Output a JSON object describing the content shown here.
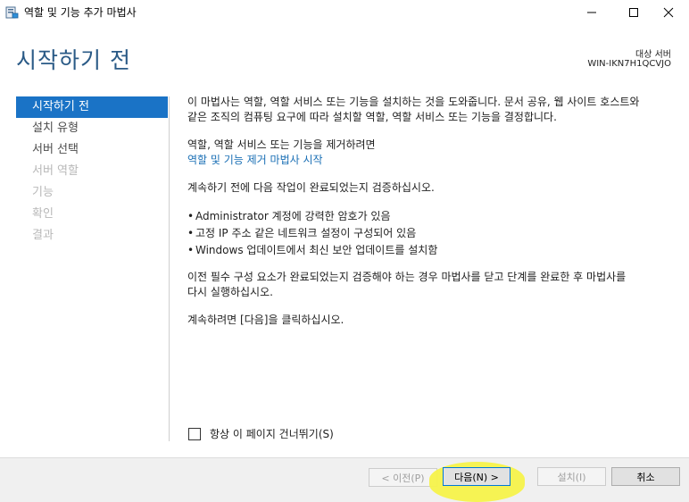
{
  "window": {
    "title": "역할 및 기능 추가 마법사",
    "icon": "server-manager-icon",
    "controls": [
      "minimize-icon",
      "maximize-icon",
      "close-icon"
    ]
  },
  "header": {
    "page_title": "시작하기 전",
    "target_label": "대상 서버",
    "target_server": "WIN-IKN7H1QCVJO"
  },
  "nav": {
    "items": [
      {
        "label": "시작하기 전",
        "state": "active"
      },
      {
        "label": "설치 유형",
        "state": "enabled"
      },
      {
        "label": "서버 선택",
        "state": "enabled"
      },
      {
        "label": "서버 역할",
        "state": "disabled"
      },
      {
        "label": "기능",
        "state": "disabled"
      },
      {
        "label": "확인",
        "state": "disabled"
      },
      {
        "label": "결과",
        "state": "disabled"
      }
    ]
  },
  "content": {
    "intro_line1": "이 마법사는 역할, 역할 서비스 또는 기능을 설치하는 것을 도와줍니다. 문서 공유, 웹 사이트 호스트와",
    "intro_line2": "같은 조직의 컴퓨팅 요구에 따라 설치할 역할, 역할 서비스 또는 기능을 결정합니다.",
    "remove_heading": "역할, 역할 서비스 또는 기능을 제거하려면",
    "remove_link": "역할 및 기능 제거 마법사 시작",
    "verify_heading": "계속하기 전에 다음 작업이 완료되었는지 검증하십시오.",
    "bullets": [
      "Administrator 계정에 강력한 암호가 있음",
      "고정 IP 주소 같은 네트워크 설정이 구성되어 있음",
      "Windows 업데이트에서 최신 보안 업데이트를 설치함"
    ],
    "prereq_line1": "이전 필수 구성 요소가 완료되었는지 검증해야 하는 경우 마법사를 닫고 단계를 완료한 후 마법사를",
    "prereq_line2": "다시 실행하십시오.",
    "continue_text": "계속하려면 [다음]을 클릭하십시오."
  },
  "skip_checkbox": {
    "label": "항상 이 페이지 건너뛰기(S)",
    "checked": false
  },
  "footer": {
    "prev_label": "< 이전(P)",
    "next_label": "다음(N) >",
    "install_label": "설치(I)",
    "cancel_label": "취소"
  },
  "colors": {
    "accent": "#1a73c6",
    "title": "#2a5a86",
    "link": "#1a6fb5",
    "highlight": "#f6f24a"
  }
}
